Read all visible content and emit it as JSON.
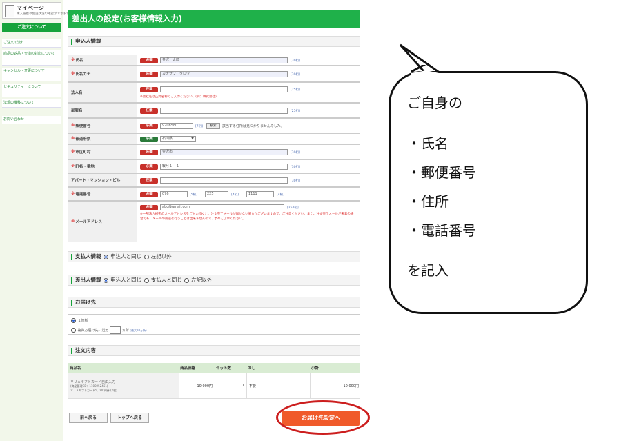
{
  "sidebar": {
    "mypage_title": "マイページ",
    "mypage_sub": "購入履歴や配送状況の確認ができます",
    "header": "ご注文について",
    "items": [
      "ご注文の流れ",
      "商品の返品・交換の対応について",
      "キャンセル・変更について",
      "セキュリティーについて",
      "法規の推移について",
      "お問い合わせ"
    ]
  },
  "page": {
    "title": "差出人の設定(お客様情報入力)"
  },
  "applicant": {
    "section": "申込人情報",
    "rows": [
      {
        "label": "氏名",
        "badge": "必須",
        "value": "金沢　太郎",
        "count": "[30桁]"
      },
      {
        "label": "氏名カナ",
        "badge": "必須",
        "value": "カナザワ　タロウ",
        "count": "[30桁]"
      },
      {
        "label": "法人名",
        "badge": "任意",
        "value": "",
        "count": "[25桁]",
        "note": "※会社名は正式名称でご入力ください。(例：株式会社)"
      },
      {
        "label": "部署名",
        "badge": "任意",
        "value": "",
        "count": "[25桁]"
      },
      {
        "label": "郵便番号",
        "badge": "必須",
        "value": "9208580",
        "count": "[7桁]",
        "search": "検索",
        "note2": "該当する住所は見つかりませんでした。"
      },
      {
        "label": "都道府県",
        "badge": "必須",
        "value": "石川県"
      },
      {
        "label": "市区町村",
        "badge": "必須",
        "value": "金沢市",
        "count": "[30桁]"
      },
      {
        "label": "町名・番地",
        "badge": "必須",
        "value": "鞍月１－１",
        "count": "[30桁]"
      },
      {
        "label": "アパート・マンション・ビル",
        "badge": "任意",
        "value": "",
        "count": "[30桁]"
      },
      {
        "label": "電話番号",
        "badge": "必須",
        "tel1": "076",
        "tel2": "225",
        "tel3": "1111",
        "c1": "[5桁]",
        "c2": "[4桁]",
        "c3": "[4桁]"
      },
      {
        "label": "メールアドレス",
        "badge": "必須",
        "value": "abc@gmail.com",
        "count": "[254桁]",
        "note": "※一部法人様宛のメールアドレスをご入力頂くと、注文完了メールが届かない場合がございますので、ご注意ください。また、注文完了メールが未着の場合でも、メールの再送を行うことは出来ませんので、予めご了承ください。"
      }
    ]
  },
  "payer": {
    "section": "支払人情報",
    "opt1": "申込人と同じ",
    "opt2": "左記以外"
  },
  "sender": {
    "section": "差出人情報",
    "opt1": "申込人と同じ",
    "opt2": "支払人と同じ",
    "opt3": "左記以外"
  },
  "delivery": {
    "section": "お届け先",
    "opt1": "１箇所",
    "opt2a": "複数お届け先に送る",
    "opt2b": "ヵ所",
    "opt2note": "(最大10ヵ所)"
  },
  "order": {
    "section": "注文内容",
    "headers": [
      "商品名",
      "商品価格",
      "セット数",
      "のし",
      "小計"
    ],
    "item_name": "ＶＪＡギフトカード自由入力",
    "item_code": "(商品管理CD：1100252461)",
    "item_desc": "ＶＪＡギフトカード5, 000円券 (2枚)",
    "price": "10,000円",
    "sets": "1",
    "noshi": "不要",
    "subtotal": "10,000円"
  },
  "buttons": {
    "back": "前へ戻る",
    "top": "トップへ戻る",
    "next": "お届け先設定へ"
  },
  "callout": {
    "line1": "ご自身の",
    "items": [
      "・氏名",
      "・郵便番号",
      "・住所",
      "・電話番号"
    ],
    "last": "を記入"
  },
  "colors": {
    "brand_green": "#1fb14a",
    "required_red": "#c8302a",
    "next_orange": "#f05a2a",
    "ring_red": "#cc1e1e"
  }
}
